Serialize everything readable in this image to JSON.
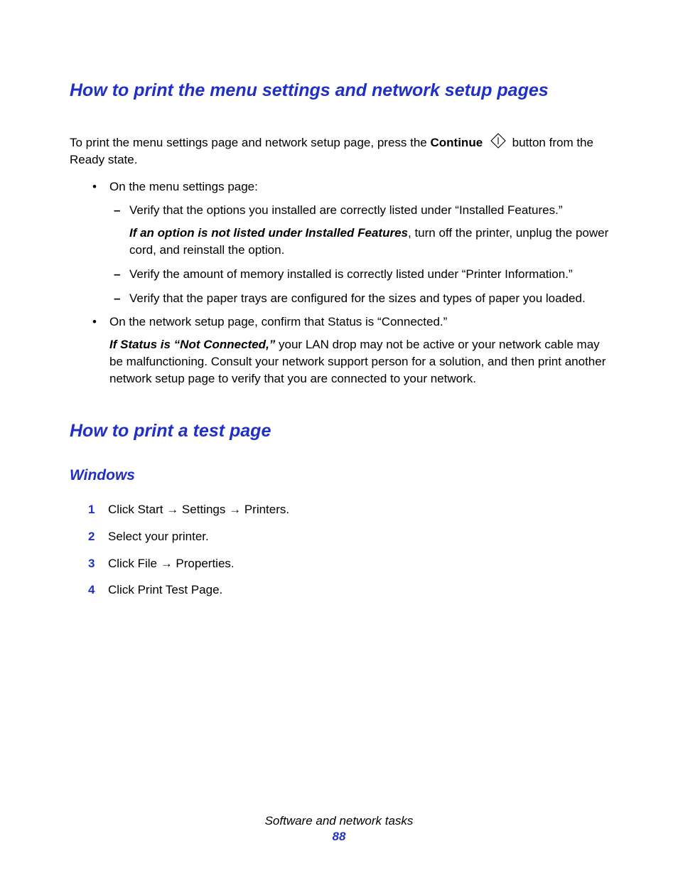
{
  "heading1": "How to print the menu settings and network setup pages",
  "intro": {
    "pre": "To print the menu settings page and network setup page, press the ",
    "continue_label": "Continue",
    "post": " button from the Ready state."
  },
  "bullets": {
    "b1": "On the menu settings page:",
    "d1": "Verify that the options you installed are correctly listed under “Installed Features.”",
    "d1_note_italic": "If an option is not listed under Installed Features",
    "d1_note_rest": ", turn off the printer, unplug the power cord, and reinstall the option.",
    "d2": "Verify the amount of memory installed is correctly listed under “Printer Information.”",
    "d3": "Verify that the paper trays are configured for the sizes and types of paper you loaded.",
    "b2": "On the network setup page, confirm that Status is “Connected.”",
    "b2_note_italic": "If Status is “Not Connected,”",
    "b2_note_rest": " your LAN drop may not be active or your network cable may be malfunctioning. Consult your network support person for a solution, and then print another network setup page to verify that you are connected to your network."
  },
  "heading2": "How to print a test page",
  "heading3": "Windows",
  "steps": {
    "s1_pre": "Click ",
    "s1_b1": "Start",
    "s1_b2": "Settings",
    "s1_b3": "Printers",
    "s1_post": ".",
    "s2": "Select your printer.",
    "s3_pre": "Click ",
    "s3_b1": "File",
    "s3_b2": "Properties",
    "s3_post": ".",
    "s4_pre": "Click ",
    "s4_b1": "Print Test Page",
    "s4_post": "."
  },
  "arrow": " → ",
  "footer": {
    "title": "Software and network tasks",
    "page": "88"
  }
}
